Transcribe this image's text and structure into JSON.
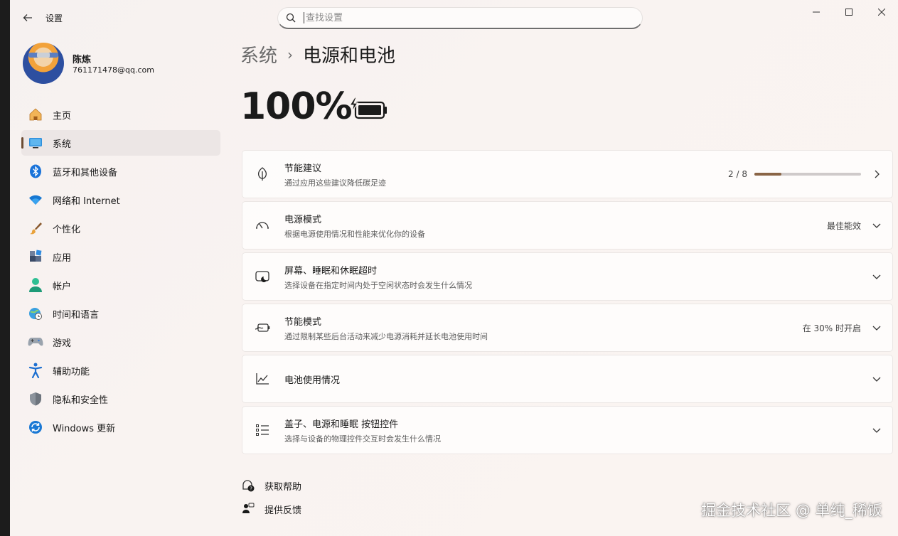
{
  "window": {
    "title": "设置",
    "controls": [
      "minimize-icon",
      "maximize-icon",
      "close-icon"
    ]
  },
  "search": {
    "placeholder": "查找设置",
    "value": ""
  },
  "profile": {
    "name": "陈炼",
    "email": "761171478@qq.com"
  },
  "nav": {
    "items": [
      {
        "label": "主页",
        "icon": "home-icon"
      },
      {
        "label": "系统",
        "icon": "system-icon",
        "active": true
      },
      {
        "label": "蓝牙和其他设备",
        "icon": "bluetooth-icon"
      },
      {
        "label": "网络和 Internet",
        "icon": "wifi-icon"
      },
      {
        "label": "个性化",
        "icon": "brush-icon"
      },
      {
        "label": "应用",
        "icon": "apps-icon"
      },
      {
        "label": "帐户",
        "icon": "account-icon"
      },
      {
        "label": "时间和语言",
        "icon": "globe-clock-icon"
      },
      {
        "label": "游戏",
        "icon": "gamepad-icon"
      },
      {
        "label": "辅助功能",
        "icon": "accessibility-icon"
      },
      {
        "label": "隐私和安全性",
        "icon": "shield-icon"
      },
      {
        "label": "Windows 更新",
        "icon": "update-icon"
      }
    ]
  },
  "breadcrumb": {
    "parent": "系统",
    "separator": "›",
    "current": "电源和电池"
  },
  "battery": {
    "percent": "100%",
    "icon": "battery-charging-icon"
  },
  "cards": [
    {
      "title": "节能建议",
      "subtitle": "通过应用这些建议降低碳足迹",
      "icon": "leaf-icon",
      "progress_text": "2 / 8",
      "progress": 0.25,
      "action": "chevron-right-icon"
    },
    {
      "title": "电源模式",
      "subtitle": "根据电源使用情况和性能来优化你的设备",
      "icon": "gauge-icon",
      "value": "最佳能效",
      "action": "chevron-down-icon"
    },
    {
      "title": "屏幕、睡眠和休眠超时",
      "subtitle": "选择设备在指定时间内处于空闲状态时会发生什么情况",
      "icon": "screen-sleep-icon",
      "action": "chevron-down-icon"
    },
    {
      "title": "节能模式",
      "subtitle": "通过限制某些后台活动来减少电源消耗并延长电池使用时间",
      "icon": "battery-saver-icon",
      "value": "在 30% 时开启",
      "action": "chevron-down-icon"
    },
    {
      "title": "电池使用情况",
      "subtitle": "",
      "icon": "chart-line-icon",
      "action": "chevron-down-icon"
    },
    {
      "title": "盖子、电源和睡眠 按钮控件",
      "subtitle": "选择与设备的物理控件交互时会发生什么情况",
      "icon": "list-icon",
      "action": "chevron-down-icon"
    }
  ],
  "help": [
    {
      "label": "获取帮助",
      "icon": "help-icon"
    },
    {
      "label": "提供反馈",
      "icon": "feedback-icon"
    }
  ],
  "watermark": "掘金技术社区 @ 单纯_稀饭",
  "colors": {
    "accent": "#6b4b33",
    "progress_fill": "#8a6546",
    "bluetooth": "#1a73d9"
  }
}
